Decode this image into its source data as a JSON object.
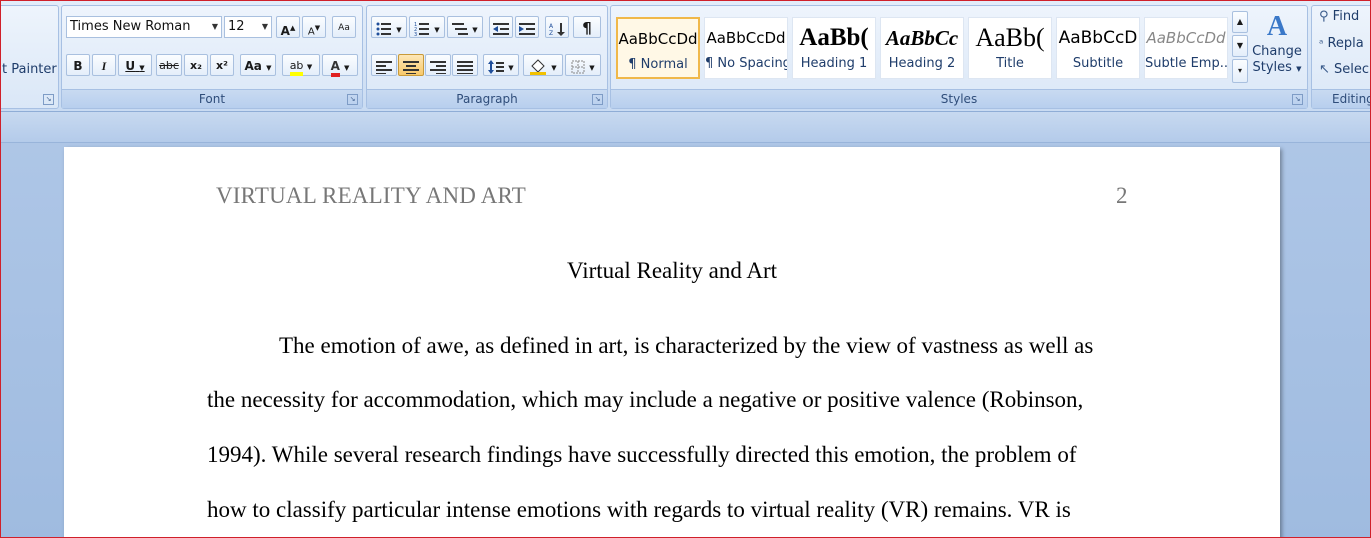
{
  "clipboard": {
    "format_painter_label": "t Painter"
  },
  "font": {
    "family": "Times New Roman",
    "size": "12",
    "grow_label": "A",
    "shrink_label": "A",
    "clear_label": "Aa",
    "bold": "B",
    "italic": "I",
    "underline": "U",
    "strike": "abc",
    "subscript": "x₂",
    "superscript": "x²",
    "change_case": "Aa",
    "highlight": "ab",
    "font_color": "A",
    "group_label": "Font"
  },
  "paragraph": {
    "show_marks": "¶",
    "group_label": "Paragraph"
  },
  "styles": {
    "tiles": [
      {
        "sample": "AaBbCcDd",
        "name": "¶ Normal"
      },
      {
        "sample": "AaBbCcDd",
        "name": "¶ No Spacing"
      },
      {
        "sample": "AaBb(",
        "name": "Heading 1"
      },
      {
        "sample": "AaBbCc",
        "name": "Heading 2"
      },
      {
        "sample": "AaBb(",
        "name": "Title"
      },
      {
        "sample": "AaBbCcD",
        "name": "Subtitle"
      },
      {
        "sample": "AaBbCcDd",
        "name": "Subtle Emp..."
      }
    ],
    "change_styles_line1": "Change",
    "change_styles_line2": "Styles",
    "group_label": "Styles"
  },
  "editing": {
    "find": "Find",
    "replace": "Repla",
    "select": "Selec",
    "group_label": "Editing"
  },
  "colors": {
    "highlight_bar": "#ffff00",
    "font_color_bar": "#e02020"
  },
  "document": {
    "header_left": "VIRTUAL REALITY AND ART",
    "page_number": "2",
    "title": "Virtual Reality and Art",
    "lines": [
      "The emotion of awe, as defined in art, is characterized by the view of vastness as well as",
      "the necessity for accommodation, which may include a negative or positive valence (Robinson,",
      "1994). While several research findings have successfully directed this emotion, the problem of",
      "how to classify particular intense emotions with regards to virtual reality (VR) remains. VR is"
    ]
  }
}
